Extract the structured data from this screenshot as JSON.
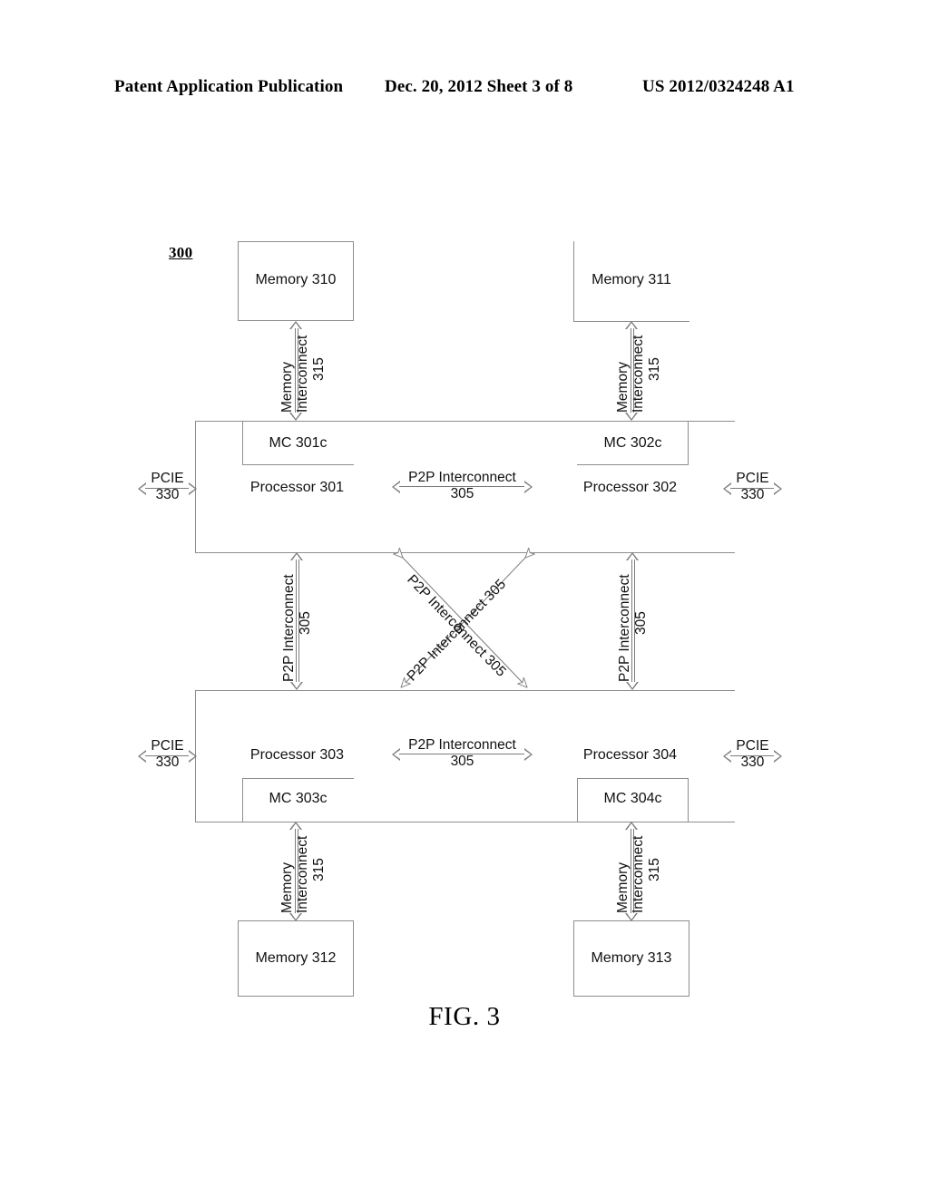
{
  "header": {
    "left": "Patent Application Publication",
    "middle": "Dec. 20, 2012   Sheet 3 of 8",
    "right": "US 2012/0324248 A1"
  },
  "figure": {
    "ref_number": "300",
    "caption": "FIG. 3",
    "memories": [
      {
        "id": "memory-310",
        "label": "Memory 310"
      },
      {
        "id": "memory-311",
        "label": "Memory 311"
      },
      {
        "id": "memory-312",
        "label": "Memory 312"
      },
      {
        "id": "memory-313",
        "label": "Memory 313"
      }
    ],
    "processors": [
      {
        "id": "processor-301",
        "label": "Processor 301",
        "mc_label": "MC 301c"
      },
      {
        "id": "processor-302",
        "label": "Processor 302",
        "mc_label": "MC 302c"
      },
      {
        "id": "processor-303",
        "label": "Processor 303",
        "mc_label": "MC 303c"
      },
      {
        "id": "processor-304",
        "label": "Processor 304",
        "mc_label": "MC 304c"
      }
    ],
    "memory_interconnect": {
      "line1": "Memory",
      "line2": "Interconnect",
      "number": "315",
      "full": "Memory Interconnect 315"
    },
    "p2p_interconnect": {
      "line1": "P2P Interconnect",
      "number": "305",
      "full": "P2P Interconnect 305"
    },
    "pcie": {
      "line1": "PCIE",
      "number": "330"
    }
  },
  "colors": {
    "line": "#8d8d8d",
    "arrow": "#7c7c7c",
    "text": "#111111",
    "background": "#ffffff"
  }
}
